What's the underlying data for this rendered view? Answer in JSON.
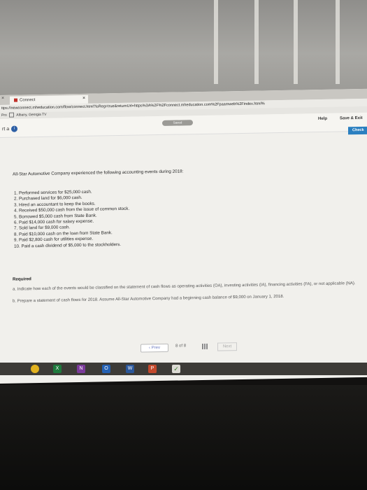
{
  "browser": {
    "tab_title": "Connect",
    "tab_close": "×",
    "url": "ttps://newconnect.mheducation.com/flow/connect.html?isReg=true&returnUrl=https%3A%2F%2Fconnect.mheducation.com%2Fpaamweb%2Findex.html%",
    "bookmarks": [
      "Pro",
      "Albany, Georgia TV"
    ]
  },
  "app": {
    "part_label": "rt a",
    "info_icon_glyph": "i",
    "saved_label": "Saved",
    "help_label": "Help",
    "save_exit_label": "Save & Exit",
    "check_label": "Check"
  },
  "problem": {
    "intro": "All-Star Automotive Company experienced the following accounting events during 2018:",
    "events": [
      "1. Performed services for $25,000 cash.",
      "2. Purchased land for $6,000 cash.",
      "3. Hired an accountant to keep the books.",
      "4. Received $50,000 cash from the issue of common stock.",
      "5. Borrowed $5,000 cash from State Bank.",
      "6. Paid $14,000 cash for salary expense.",
      "7. Sold land for $9,000 cash.",
      "8. Paid $10,000 cash on the loan from State Bank.",
      "9. Paid $2,800 cash for utilities expense.",
      "10. Paid a cash dividend of $5,000 to the stockholders."
    ],
    "required_label": "Required",
    "req_a": "a. Indicate how each of the events would be classified on the statement of cash flows as operating activities (OA), investing activities (IA), financing activities (FA), or not applicable (NA).",
    "req_b": "b. Prepare a statement of cash flows for 2018. Assume All-Star Automotive Company had a beginning cash balance of $9,000 on January 1, 2018."
  },
  "pagination": {
    "prev_label": "‹ Prev",
    "page_current": "8",
    "page_of": "of",
    "page_total": "8",
    "next_label": "Next"
  },
  "taskbar": {
    "apps": [
      {
        "name": "chrome",
        "color": "#e2b21f"
      },
      {
        "name": "excel",
        "label": "X",
        "color": "#1f7a3d"
      },
      {
        "name": "onenote",
        "label": "N",
        "color": "#7b3a9a"
      },
      {
        "name": "outlook",
        "label": "O",
        "color": "#2461b3"
      },
      {
        "name": "word",
        "label": "W",
        "color": "#2b579a"
      },
      {
        "name": "powerpoint",
        "label": "P",
        "color": "#c3482b"
      }
    ],
    "check_glyph": "✓"
  }
}
